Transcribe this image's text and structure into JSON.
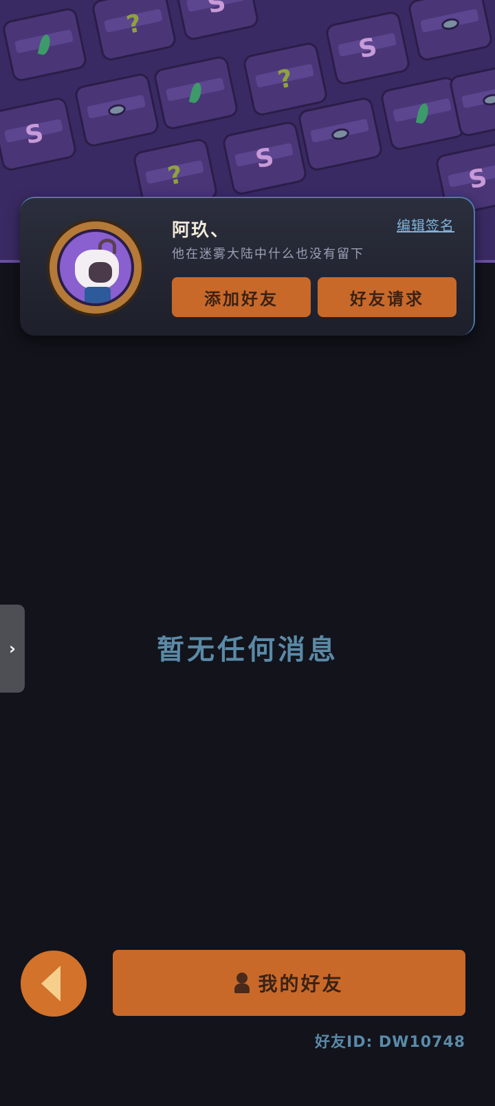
{
  "profile": {
    "username": "阿玖、",
    "edit_signature_label": "编辑签名",
    "signature": "他在迷雾大陆中什么也没有留下",
    "add_friend_label": "添加好友",
    "friend_request_label": "好友请求"
  },
  "messages": {
    "empty_text": "暂无任何消息"
  },
  "side_tab": {
    "icon_glyph": "›"
  },
  "bottom": {
    "my_friends_label": "我的好友",
    "friend_id_text": "好友ID: DW10748"
  },
  "colors": {
    "accent": "#c8692a",
    "background": "#12131b",
    "banner": "#3a2a63",
    "muted_blue": "#5a8aa8"
  },
  "banner_pattern": {
    "glyphs": [
      "S",
      "?",
      "S",
      "?",
      "S",
      "?",
      "S"
    ]
  }
}
